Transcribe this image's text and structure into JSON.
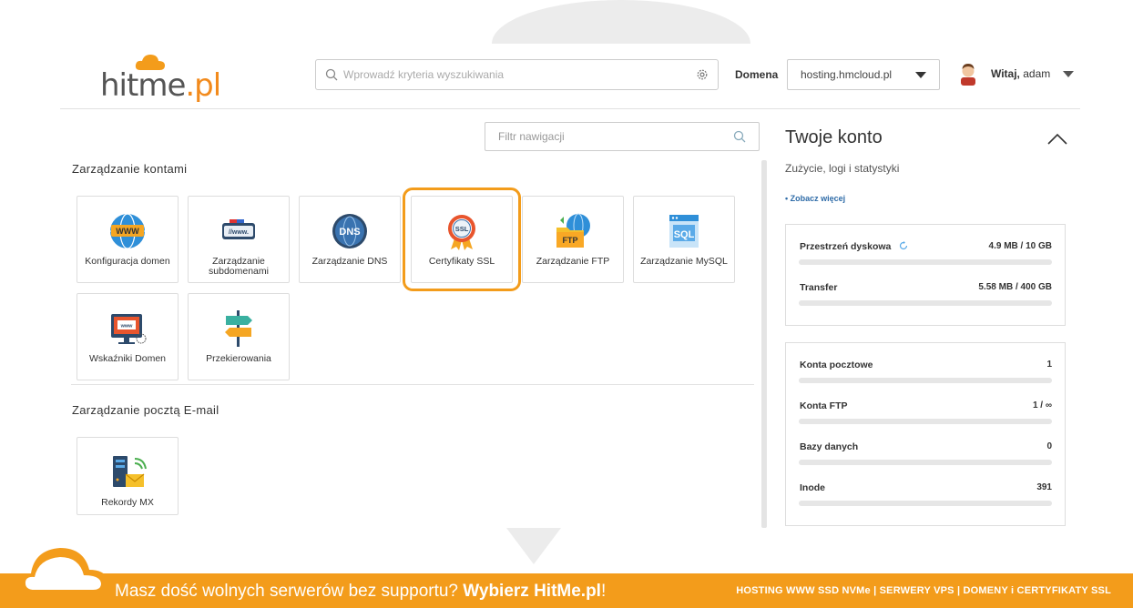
{
  "header": {
    "logo_text_a": "hitme",
    "logo_text_b": ".pl",
    "search_placeholder": "Wprowadź kryteria wyszukiwania",
    "domain_label": "Domena",
    "domain_value": "hosting.hmcloud.pl",
    "welcome_bold": "Witaj,",
    "welcome_user": "adam"
  },
  "nav": {
    "filter_placeholder": "Filtr nawigacji",
    "sections": [
      {
        "title": "Zarządzanie kontami",
        "tiles": [
          {
            "label": "Konfiguracja domen",
            "icon": "www-globe-icon"
          },
          {
            "label": "Zarządzanie subdomenami",
            "icon": "subdomain-link-icon"
          },
          {
            "label": "Zarządzanie DNS",
            "icon": "dns-globe-icon"
          },
          {
            "label": "Certyfikaty SSL",
            "icon": "ssl-badge-icon"
          },
          {
            "label": "Zarządzanie FTP",
            "icon": "ftp-folder-icon"
          },
          {
            "label": "Zarządzanie MySQL",
            "icon": "sql-database-icon"
          },
          {
            "label": "Wskaźniki Domen",
            "icon": "monitor-www-icon"
          },
          {
            "label": "Przekierowania",
            "icon": "signpost-icon"
          }
        ]
      },
      {
        "title": "Zarządzanie pocztą E-mail",
        "tiles": [
          {
            "label": "Rekordy MX",
            "icon": "mail-server-icon"
          }
        ]
      }
    ]
  },
  "account": {
    "title": "Twoje konto",
    "subtitle": "Zużycie, logi i statystyki",
    "more": "• Zobacz więcej",
    "usage": [
      {
        "name": "Przestrzeń dyskowa",
        "value": "4.9 MB / 10 GB"
      },
      {
        "name": "Transfer",
        "value": "5.58 MB / 400 GB"
      }
    ],
    "counts": [
      {
        "name": "Konta pocztowe",
        "value": "1"
      },
      {
        "name": "Konta FTP",
        "value": "1 / ∞"
      },
      {
        "name": "Bazy danych",
        "value": "0"
      },
      {
        "name": "Inode",
        "value": "391"
      }
    ]
  },
  "footer": {
    "left_text": "Masz dość wolnych serwerów bez supportu? ",
    "left_bold": "Wybierz HitMe.pl",
    "left_end": "!",
    "right_text": "HOSTING WWW SSD NVMe | SERWERY VPS | DOMENY i CERTYFIKATY SSL"
  },
  "colors": {
    "accent": "#f39c1b",
    "link": "#2f6ca8"
  }
}
